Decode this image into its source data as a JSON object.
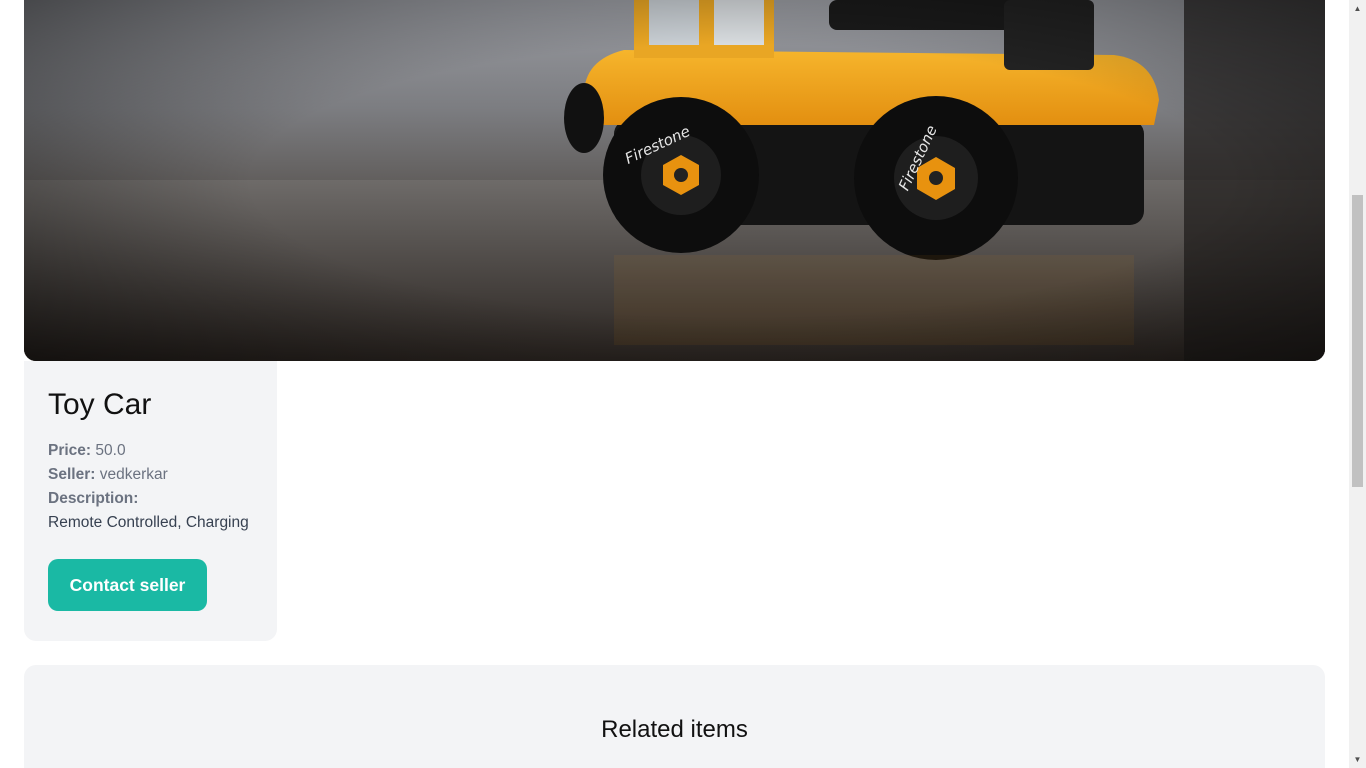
{
  "product": {
    "title": "Toy Car",
    "price_label": "Price:",
    "price_value": "50.0",
    "seller_label": "Seller:",
    "seller_value": "vedkerkar",
    "description_label": "Description:",
    "description_value": "Remote Controlled, Charging",
    "contact_button": "Contact seller"
  },
  "related": {
    "heading": "Related items"
  },
  "colors": {
    "accent": "#1ab9a4",
    "card_bg": "#f3f4f6"
  },
  "scrollbar": {
    "up_icon": "chevron-up-icon",
    "down_icon": "chevron-down-icon"
  }
}
